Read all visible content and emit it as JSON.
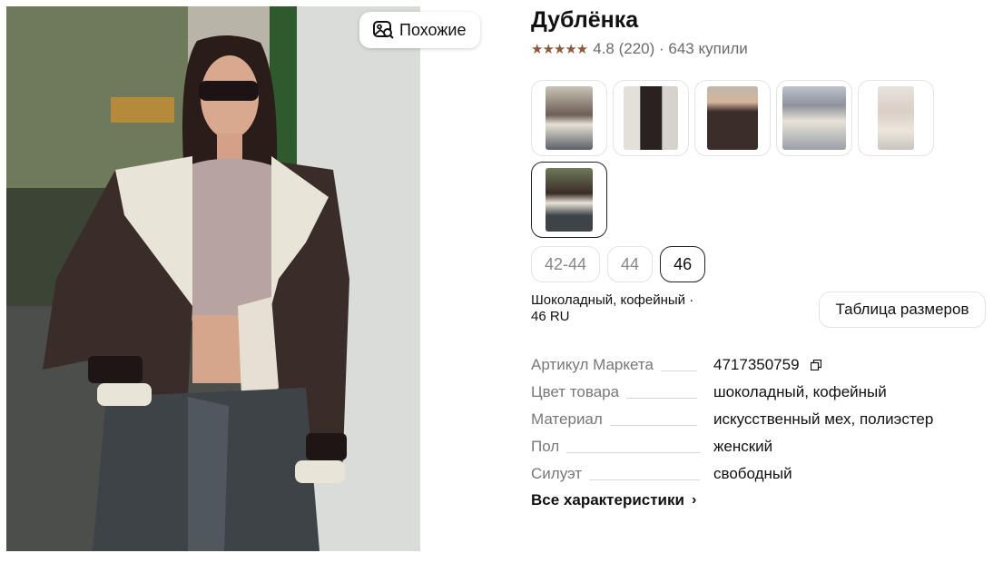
{
  "product": {
    "title": "Дублёнка",
    "rating_stars": "★★★★★",
    "rating_text": "4.8 (220) · 643 купили"
  },
  "similar_button": {
    "label": "Похожие"
  },
  "thumbnails": [
    {
      "name": "thumbnail-1"
    },
    {
      "name": "thumbnail-2"
    },
    {
      "name": "thumbnail-3"
    },
    {
      "name": "thumbnail-4"
    },
    {
      "name": "thumbnail-5"
    },
    {
      "name": "thumbnail-6",
      "selected": true
    }
  ],
  "sizes": [
    {
      "label": "42-44",
      "selected": false
    },
    {
      "label": "44",
      "selected": false
    },
    {
      "label": "46",
      "selected": true
    }
  ],
  "variant": {
    "line1": "Шоколадный, кофейный ·",
    "line2": "46 RU"
  },
  "size_table_button": "Таблица размеров",
  "specs": [
    {
      "name": "Артикул Маркета",
      "value": "4717350759"
    },
    {
      "name": "Цвет товара",
      "value": "шоколадный, кофейный"
    },
    {
      "name": "Материал",
      "value": "искусственный мех, полиэстер"
    },
    {
      "name": "Пол",
      "value": "женский"
    },
    {
      "name": "Силуэт",
      "value": "свободный"
    }
  ],
  "all_specs_link": "Все характеристики",
  "colors": {
    "star": "#8a5a3b",
    "border": "#e3e3e3",
    "selected_border": "#222222",
    "muted_text": "#777777"
  }
}
